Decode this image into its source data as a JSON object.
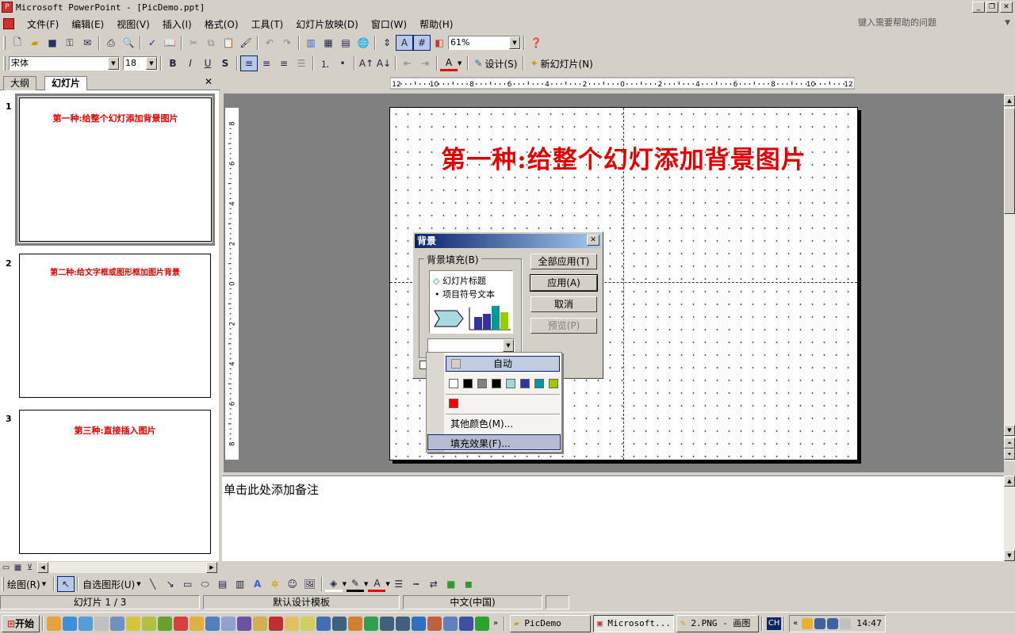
{
  "window": {
    "title": "Microsoft PowerPoint - [PicDemo.ppt]"
  },
  "menu": [
    "文件(F)",
    "编辑(E)",
    "视图(V)",
    "插入(I)",
    "格式(O)",
    "工具(T)",
    "幻灯片放映(D)",
    "窗口(W)",
    "帮助(H)"
  ],
  "help_placeholder": "键入需要帮助的问题",
  "toolbar": {
    "zoom": "61%",
    "font": "宋体",
    "size": "18",
    "design": "设计(S)",
    "new_slide": "新幻灯片(N)"
  },
  "tabs": {
    "outline": "大纲",
    "slides": "幻灯片"
  },
  "thumbnails": [
    {
      "num": "1",
      "title": "第一种:给整个幻灯添加背景图片"
    },
    {
      "num": "2",
      "title": "第二种:给文字框或图形框加图片背景"
    },
    {
      "num": "3",
      "title": "第三种:直接插入图片"
    }
  ],
  "ruler": {
    "h": [
      "12",
      "10",
      "8",
      "6",
      "4",
      "2",
      "0",
      "2",
      "4",
      "6",
      "8",
      "10",
      "12"
    ],
    "v": [
      "8",
      "6",
      "4",
      "2",
      "0",
      "2",
      "4",
      "6",
      "8"
    ]
  },
  "slide": {
    "title": "第一种:给整个幻灯添加背景图片"
  },
  "dialog": {
    "title": "背景",
    "group": "背景填充(B)",
    "preview_title": "幻灯片标题",
    "preview_bullet": "项目符号文本",
    "buttons": [
      "全部应用(T)",
      "应用(A)",
      "取消",
      "预览(P)"
    ]
  },
  "popup": {
    "auto": "自动",
    "swatches": [
      "#ffffff",
      "#000000",
      "#808080",
      "#000000",
      "#a0d8d8",
      "#333399",
      "#009999",
      "#99cc00"
    ],
    "recent": [
      "#ff0000"
    ],
    "more": "其他颜色(M)...",
    "fill": "填充效果(F)..."
  },
  "notes": {
    "placeholder": "单击此处添加备注"
  },
  "draw": {
    "draw": "绘图(R)",
    "autoshapes": "自选图形(U)"
  },
  "status": {
    "slide": "幻灯片 1 / 3",
    "template": "默认设计模板",
    "lang": "中文(中国)"
  },
  "taskbar": {
    "start": "开始",
    "tasks": [
      "PicDemo",
      "Microsoft...",
      "2.PNG - 画图"
    ],
    "ime": "CH",
    "time": "14:47"
  },
  "colors": {
    "accent_red": "#dd0000",
    "title_gradient_start": "#0a246a"
  }
}
